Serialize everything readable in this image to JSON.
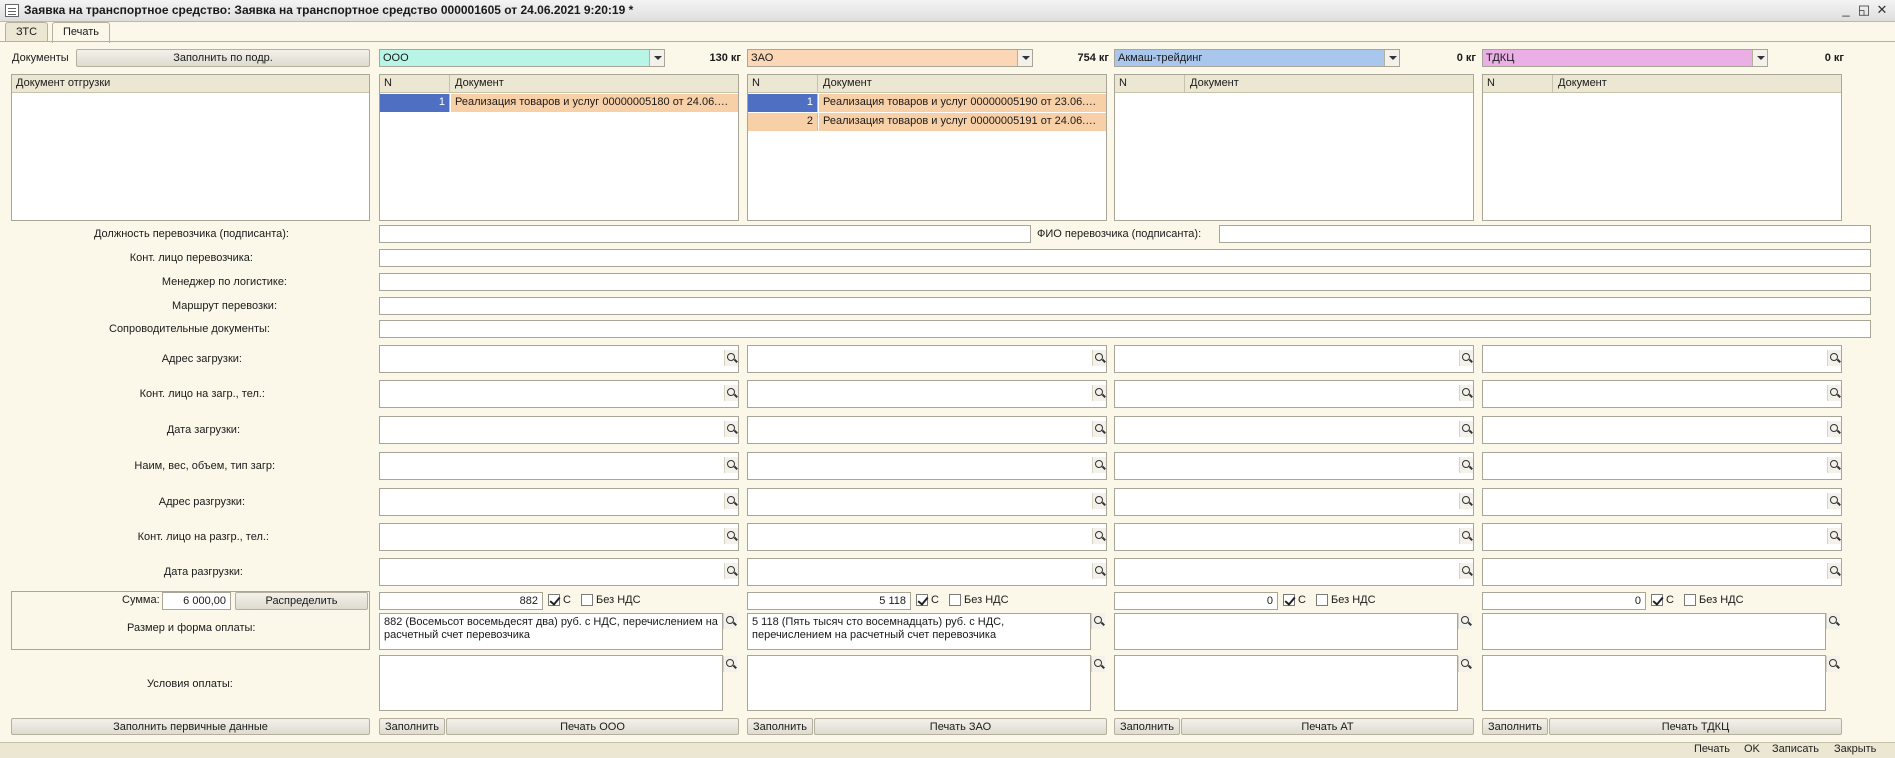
{
  "window": {
    "title": "Заявка на транспортное средство: Заявка на транспортное средство 000001605 от 24.06.2021 9:20:19 *",
    "controls": [
      "_",
      "◱",
      "✕"
    ]
  },
  "tabs": [
    "ЗТС",
    "Печать"
  ],
  "top": {
    "documents_label": "Документы",
    "fill_by_sub_button": "Заполнить по подр.",
    "shipment_doc_header": "Документ отгрузки"
  },
  "columns": [
    {
      "company": "ООО",
      "color": "#b9f5e6",
      "weight": "130 кг",
      "grid_head_n": "N",
      "grid_head_doc": "Документ",
      "rows": [
        {
          "n": "1",
          "doc": "Реализация товаров и услуг 00000005180 от 24.06.20..."
        }
      ],
      "sum": "882",
      "with_vat_label": "С",
      "with_vat": true,
      "no_vat_label": "Без НДС",
      "no_vat": false,
      "payment": "882 (Восемьсот восемьдесят два) руб. с НДС, перечислением на расчетный счет перевозчика",
      "fill_button": "Заполнить",
      "print_button": "Печать ООО"
    },
    {
      "company": "ЗАО",
      "color": "#fcd7b5",
      "weight": "754 кг",
      "grid_head_n": "N",
      "grid_head_doc": "Документ",
      "rows": [
        {
          "n": "1",
          "doc": "Реализация товаров и услуг 00000005190 от 23.06.20..."
        },
        {
          "n": "2",
          "doc": "Реализация товаров и услуг 00000005191 от 24.06.20..."
        }
      ],
      "sum": "5 118",
      "with_vat_label": "С",
      "with_vat": true,
      "no_vat_label": "Без НДС",
      "no_vat": false,
      "payment": "5 118 (Пять тысяч сто восемнадцать) руб. с НДС, перечислением на расчетный счет перевозчика",
      "fill_button": "Заполнить",
      "print_button": "Печать ЗАО"
    },
    {
      "company": "Акмаш-трейдинг",
      "color": "#a9c6ec",
      "weight": "0 кг",
      "grid_head_n": "N",
      "grid_head_doc": "Документ",
      "rows": [],
      "sum": "0",
      "with_vat_label": "С",
      "with_vat": true,
      "no_vat_label": "Без НДС",
      "no_vat": false,
      "payment": "",
      "fill_button": "Заполнить",
      "print_button": "Печать АТ"
    },
    {
      "company": "ТДКЦ",
      "color": "#eab0e6",
      "weight": "0 кг",
      "grid_head_n": "N",
      "grid_head_doc": "Документ",
      "rows": [],
      "sum": "0",
      "with_vat_label": "С",
      "with_vat": true,
      "no_vat_label": "Без НДС",
      "no_vat": false,
      "payment": "",
      "fill_button": "Заполнить",
      "print_button": "Печать ТДКЦ"
    }
  ],
  "carrier": {
    "position_label": "Должность перевозчика (подписанта):",
    "position_value": "",
    "fio_label": "ФИО перевозчика (подписанта):",
    "fio_value": "",
    "contact_label": "Конт. лицо перевозчика:",
    "manager_label": "Менеджер по логистике:",
    "route_label": "Маршрут перевозки:",
    "docs_label": "Сопроводительные документы:"
  },
  "address_rows": [
    "Адрес загрузки:",
    "Конт. лицо на загр., тел.:",
    "Дата загрузки:",
    "Наим, вес, объем, тип загр:",
    "Адрес разгрузки:",
    "Конт. лицо на разгр., тел.:",
    "Дата разгрузки:"
  ],
  "payment_block": {
    "sum_label": "Сумма:",
    "sum_value": "6 000,00",
    "distribute_button": "Распределить",
    "form_label": "Размер и форма оплаты:",
    "conditions_label": "Условия оплаты:"
  },
  "bottom": {
    "fill_primary_button": "Заполнить первичные данные"
  },
  "statusbar": [
    "Печать",
    "OK",
    "Записать",
    "Закрыть"
  ]
}
